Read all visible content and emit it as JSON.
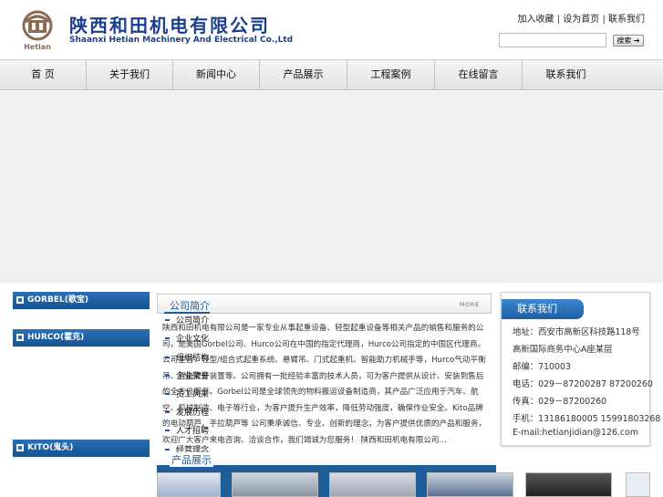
{
  "header": {
    "logo_cn": "陕西和田机电有限公司",
    "logo_en": "Shaanxi Hetian Machinery And Electrical Co.,Ltd",
    "logo_emblem_text": "Hetian",
    "top_links": [
      "加入收藏",
      "设为首页",
      "联系我们"
    ],
    "search_button": "搜索"
  },
  "nav": {
    "items": [
      "首 页",
      "关于我们",
      "新闻中心",
      "产品展示",
      "工程案例",
      "在线留言",
      "联系我们"
    ]
  },
  "sidebar": {
    "categories": [
      "GORBEL(歌宝)",
      "HURCO(霍克)",
      "KITO(鬼头)"
    ]
  },
  "about": {
    "title": "公司简介",
    "more": "MORE",
    "text": "陕西和田机电有限公司是一家专业从事起重设备、轻型起重设备等相关产品的销售和服务的公司，是美国Gorbel公司、Hurco公司在中国的指定代理商，Hurco公司指定的中国区代理商。公司主营：轻型/组合式起重系统、悬臂吊、门式起重机、智能助力机械手等，Hurco气动平衡吊、智能提升装置等。公司拥有一批经验丰富的技术人员，可为客户提供从设计、安装到售后的全方位服务。Gorbel公司是全球领先的物料搬运设备制造商，其产品广泛应用于汽车、航空、机械制造、电子等行业，为客户提升生产效率，降低劳动强度，确保作业安全。Kito品牌的电动葫芦、手拉葫芦等    公司秉承诚信、专业、创新的理念，为客户提供优质的产品和服务，欢迎广大客户来电咨询、洽谈合作，我们竭诚为您服务！    陕西和田机电有限公司..."
  },
  "menu": {
    "items": [
      "公司简介",
      "企业文化",
      "组织结构",
      "企业荣誉",
      "员工风采",
      "发展历程",
      "人才招聘",
      "经营理念",
      "联系方式"
    ]
  },
  "products": {
    "title": "产品展示"
  },
  "contact": {
    "title": "联系我们",
    "lines": [
      "地址：西安市高新区科技路118号",
      "高新国际商务中心A座某层",
      "邮编：710003",
      "电话：029－87200287 87200260",
      "传真：029－87200260",
      "手机：13186180005 15991803268",
      "E-mail:hetianjidian@126.com"
    ]
  },
  "colors": {
    "brand_blue": "#1f5c9a",
    "logo_blue": "#1b3f8c",
    "logo_brown": "#8c6a55"
  }
}
